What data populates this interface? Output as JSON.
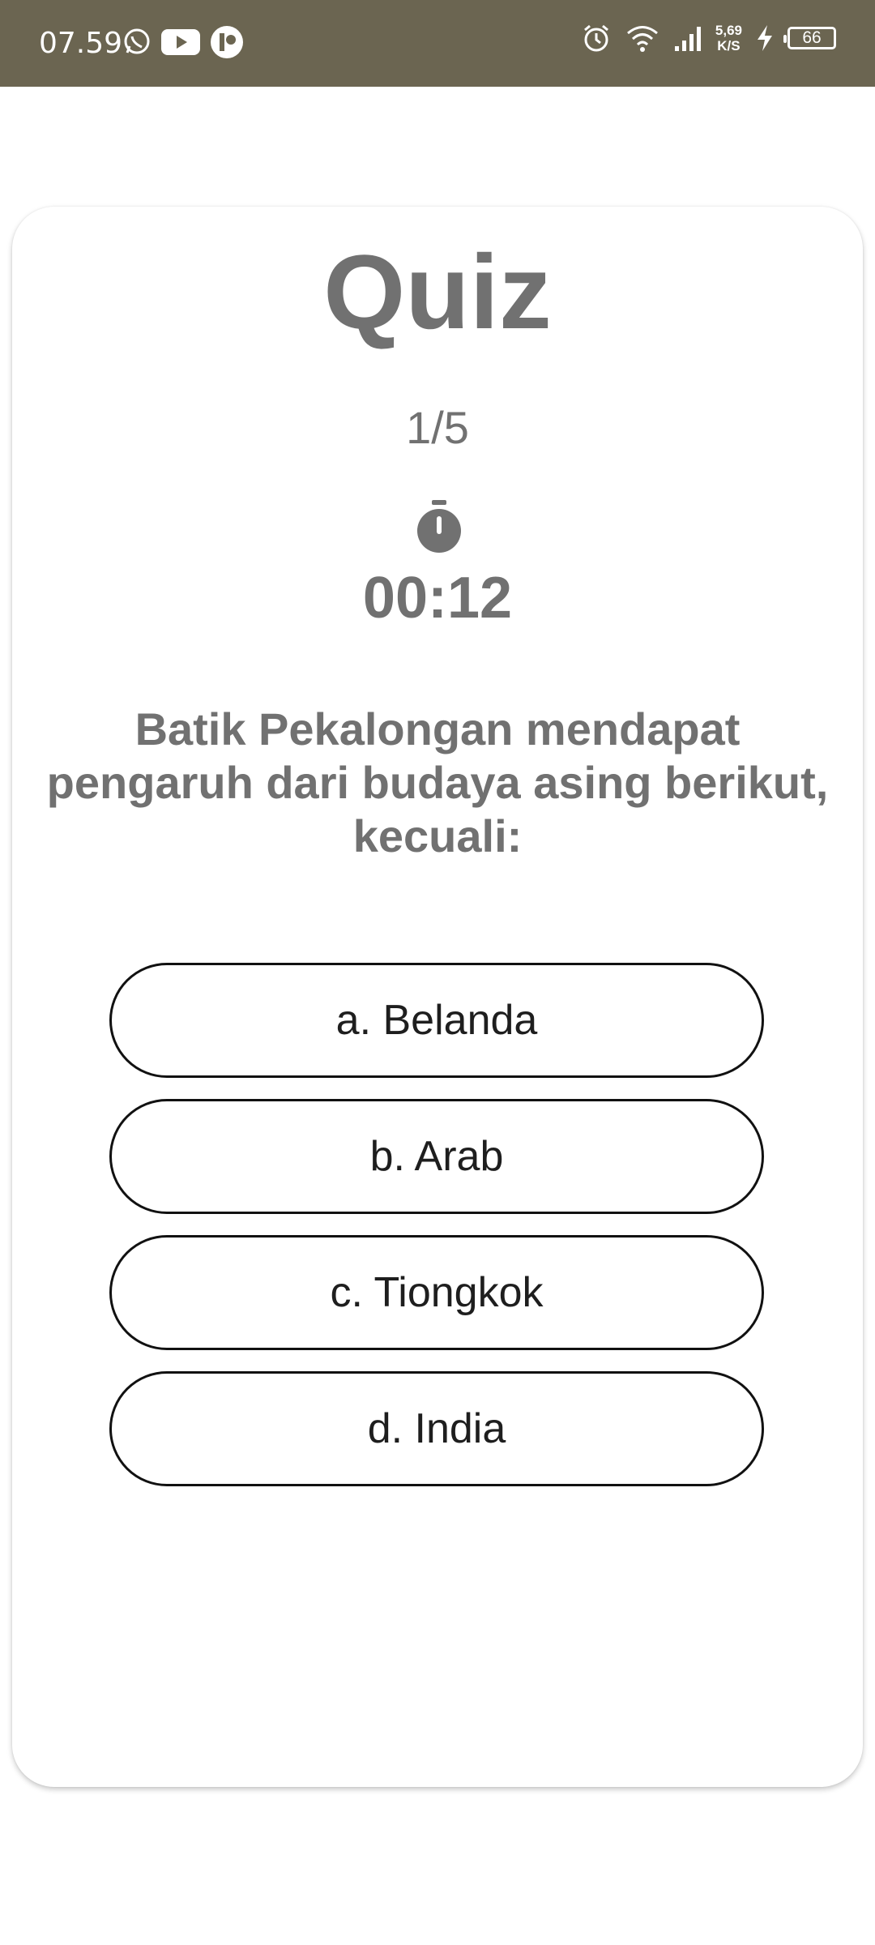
{
  "status_bar": {
    "time": "07.59",
    "left_icons": [
      "whatsapp-icon",
      "youtube-icon",
      "app-icon"
    ],
    "right_icons": [
      "alarm-icon",
      "wifi-icon",
      "signal-icon",
      "charging-icon"
    ],
    "network_speed_value": "5,69",
    "network_speed_unit": "K/S",
    "battery": "66"
  },
  "quiz": {
    "title": "Quiz",
    "progress": "1/5",
    "timer_icon": "stopwatch-icon",
    "timer": "00:12",
    "question": "Batik Pekalongan mendapat pengaruh dari budaya asing berikut, kecuali:",
    "options": [
      {
        "label": "a. Belanda"
      },
      {
        "label": "b. Arab"
      },
      {
        "label": "c. Tiongkok"
      },
      {
        "label": "d. India"
      }
    ]
  },
  "colors": {
    "status_bar_bg": "#6b6551",
    "primary_text": "#717171",
    "option_border": "#111111"
  }
}
